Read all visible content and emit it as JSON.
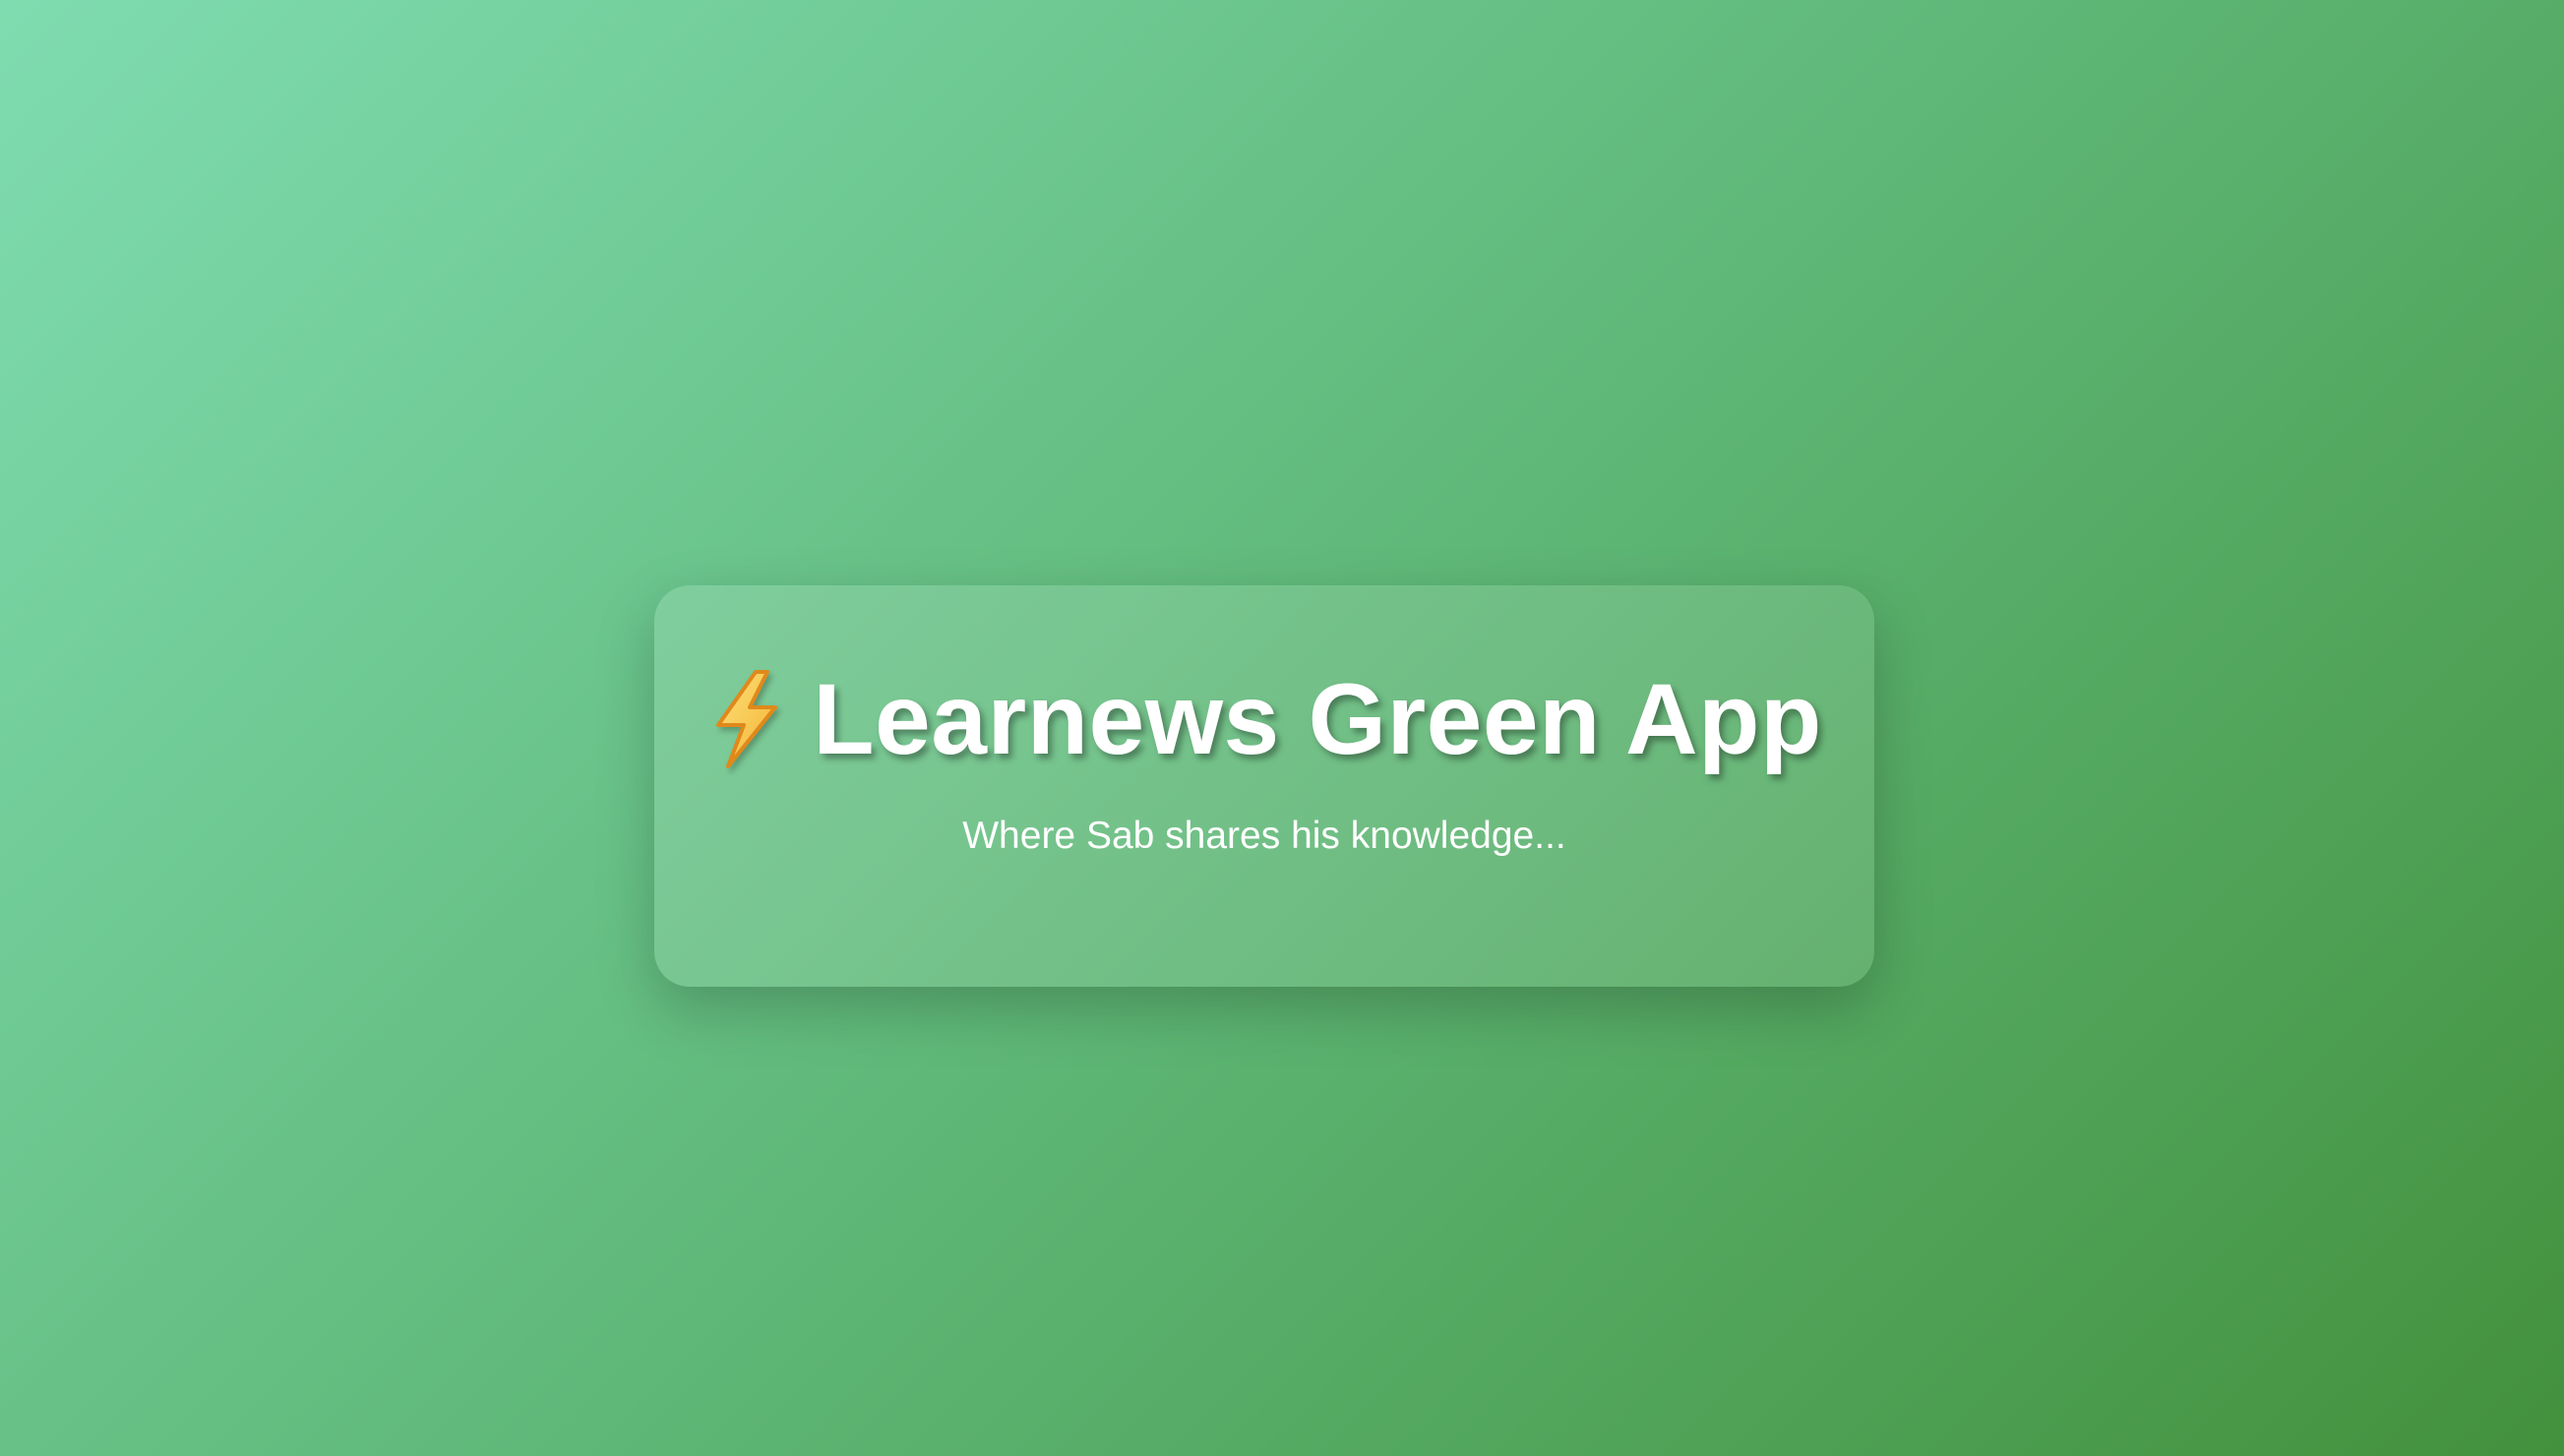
{
  "card": {
    "icon": "lightning-bolt-icon",
    "title": "Learnews Green App",
    "subtitle": "Where Sab shares his knowledge..."
  },
  "colors": {
    "background_start": "#7fdcb0",
    "background_end": "#43913d",
    "text": "#ffffff",
    "bolt_fill": "#f9c945",
    "bolt_stroke": "#e28a1c"
  }
}
